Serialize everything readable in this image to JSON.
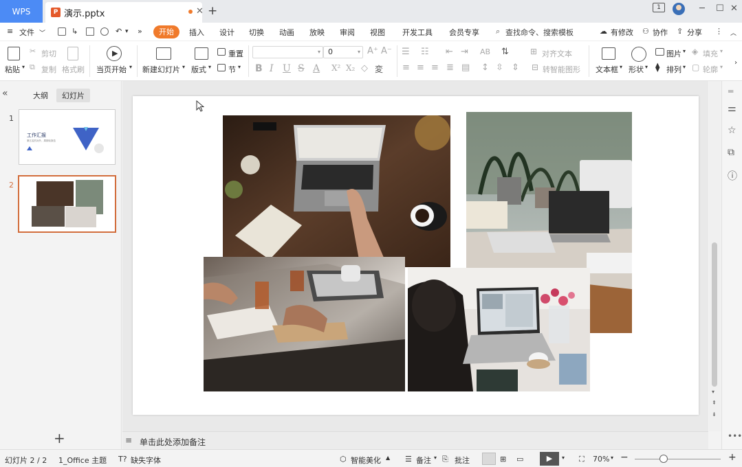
{
  "titlebar": {
    "app_tab": "WPS",
    "doc_tab": "演示.pptx",
    "doc_icon": "P"
  },
  "menubar": {
    "file": "文件",
    "tabs": [
      "开始",
      "插入",
      "设计",
      "切换",
      "动画",
      "放映",
      "审阅",
      "视图",
      "开发工具",
      "会员专享"
    ],
    "search": "查找命令、搜索模板",
    "has_changes": "有修改",
    "collaborate": "协作",
    "share": "分享"
  },
  "ribbon": {
    "paste": "粘贴",
    "cut": "剪切",
    "copy": "复制",
    "format_painter": "格式刷",
    "start_from_page": "当页开始",
    "new_slide": "新建幻灯片",
    "layout": "版式",
    "reset": "重置",
    "section": "节",
    "font_size": "0",
    "align_text": "对齐文本",
    "smart_graphic": "转智能图形",
    "textbox": "文本框",
    "shape": "形状",
    "picture": "图片",
    "arrange": "排列",
    "fill": "填充",
    "outline": "轮廓"
  },
  "leftpanel": {
    "outline_tab": "大纲",
    "slides_tab": "幻灯片",
    "slides": [
      {
        "num": "1",
        "title": "工作汇报",
        "subtitle": "第五名的对外，周期化报告"
      },
      {
        "num": "2"
      }
    ]
  },
  "notes": {
    "placeholder": "单击此处添加备注"
  },
  "statusbar": {
    "slide_counter": "幻灯片 2 / 2",
    "theme": "1_Office 主题",
    "missing_font": "缺失字体",
    "beautify": "智能美化",
    "notes": "备注",
    "comments": "批注",
    "zoom": "70%"
  },
  "colors": {
    "accent": "#f07a2b",
    "wps_blue": "#4c8bf5",
    "selection": "#d26d3c"
  }
}
